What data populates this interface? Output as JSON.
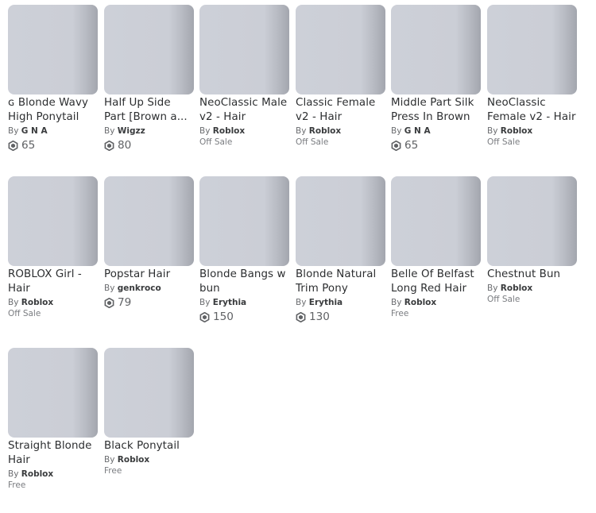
{
  "items": [
    {
      "name": "ɢ Blonde Wavy High Ponytail",
      "by": "By",
      "creator": "G N A",
      "price": "65",
      "price_type": "robux"
    },
    {
      "name": "Half Up Side Part [Brown a...",
      "by": "By",
      "creator": "Wigzz",
      "price": "80",
      "price_type": "robux"
    },
    {
      "name": "NeoClassic Male v2 - Hair",
      "by": "By",
      "creator": "Roblox",
      "price": "Off Sale",
      "price_type": "text"
    },
    {
      "name": "Classic Female v2 - Hair",
      "by": "By",
      "creator": "Roblox",
      "price": "Off Sale",
      "price_type": "text"
    },
    {
      "name": "Middle Part Silk Press In Brown",
      "by": "By",
      "creator": "G N A",
      "price": "65",
      "price_type": "robux"
    },
    {
      "name": "NeoClassic Female v2 - Hair",
      "by": "By",
      "creator": "Roblox",
      "price": "Off Sale",
      "price_type": "text"
    },
    {
      "name": "ROBLOX Girl - Hair",
      "by": "By",
      "creator": "Roblox",
      "price": "Off Sale",
      "price_type": "text"
    },
    {
      "name": "Popstar Hair",
      "by": "By",
      "creator": "genkroco",
      "price": "79",
      "price_type": "robux"
    },
    {
      "name": "Blonde Bangs w bun",
      "by": "By",
      "creator": "Erythia",
      "price": "150",
      "price_type": "robux"
    },
    {
      "name": "Blonde Natural Trim Pony",
      "by": "By",
      "creator": "Erythia",
      "price": "130",
      "price_type": "robux"
    },
    {
      "name": "Belle Of Belfast Long Red Hair",
      "by": "By",
      "creator": "Roblox",
      "price": "Free",
      "price_type": "text"
    },
    {
      "name": "Chestnut Bun",
      "by": "By",
      "creator": "Roblox",
      "price": "Off Sale",
      "price_type": "text"
    },
    {
      "name": "Straight Blonde Hair",
      "by": "By",
      "creator": "Roblox",
      "price": "Free",
      "price_type": "text"
    },
    {
      "name": "Black Ponytail",
      "by": "By",
      "creator": "Roblox",
      "price": "Free",
      "price_type": "text"
    }
  ],
  "colors": {
    "thumbnail": "#cdd0d8",
    "text": "#2c2e30",
    "muted": "#7a7c80"
  },
  "icons": {
    "currency": "robux-icon"
  }
}
